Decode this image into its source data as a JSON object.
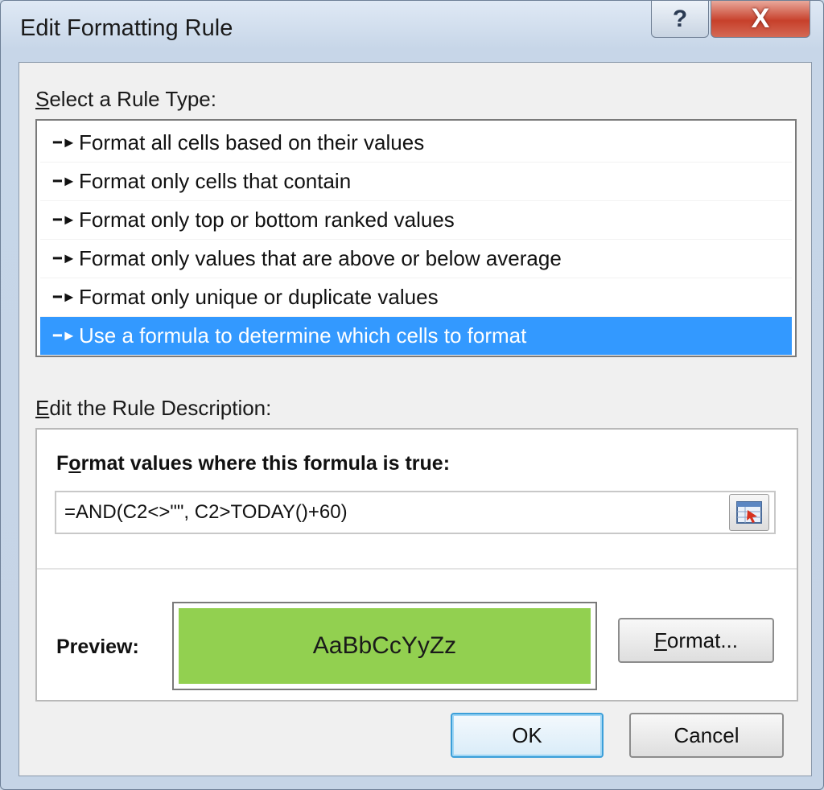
{
  "window": {
    "title": "Edit Formatting Rule",
    "help_label": "?",
    "close_label": "X"
  },
  "rule_type": {
    "label_first": "S",
    "label_rest": "elect a Rule Type:",
    "items": [
      {
        "label": "Format all cells based on their values",
        "selected": false
      },
      {
        "label": "Format only cells that contain",
        "selected": false
      },
      {
        "label": "Format only top or bottom ranked values",
        "selected": false
      },
      {
        "label": "Format only values that are above or below average",
        "selected": false
      },
      {
        "label": "Format only unique or duplicate values",
        "selected": false
      },
      {
        "label": "Use a formula to determine which cells to format",
        "selected": true
      }
    ]
  },
  "description": {
    "label_first": "E",
    "label_rest": "dit the Rule Description:",
    "formula_heading_a": "F",
    "formula_heading_o": "o",
    "formula_heading_rest": "rmat values where this formula is true:",
    "formula_value": "=AND(C2<>\"\", C2>TODAY()+60)",
    "preview_label": "Preview:",
    "preview_text": "AaBbCcYyZz",
    "preview_color": "#92d050",
    "format_button_first": "F",
    "format_button_rest": "ormat..."
  },
  "buttons": {
    "ok": "OK",
    "cancel": "Cancel"
  }
}
